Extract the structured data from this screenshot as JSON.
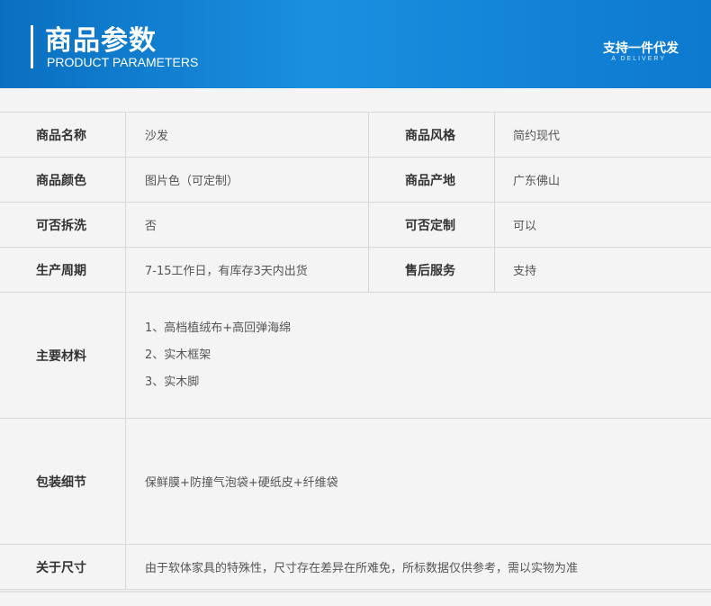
{
  "banner": {
    "title_cn": "商品参数",
    "title_en": "PRODUCT PARAMETERS",
    "slogan_cn": "支持一件代发",
    "slogan_en": "A DELIVERY"
  },
  "rows": [
    {
      "label_left": "商品名称",
      "value_left": "沙发",
      "label_right": "商品风格",
      "value_right": "简约现代"
    },
    {
      "label_left": "商品颜色",
      "value_left": "图片色（可定制）",
      "label_right": "商品产地",
      "value_right": "广东佛山"
    },
    {
      "label_left": "可否拆洗",
      "value_left": "否",
      "label_right": "可否定制",
      "value_right": "可以"
    },
    {
      "label_left": "生产周期",
      "value_left": "7-15工作日，有库存3天内出货",
      "label_right": "售后服务",
      "value_right": "支持"
    }
  ],
  "materials": {
    "label": "主要材料",
    "items": [
      "1、高档植绒布+高回弹海绵",
      "2、实木框架",
      "3、实木脚"
    ]
  },
  "packing": {
    "label": "包装细节",
    "value": "保鲜膜+防撞气泡袋+硬纸皮+纤维袋"
  },
  "size": {
    "label": "关于尺寸",
    "value": "由于软体家具的特殊性，尺寸存在差异在所难免，所标数据仅供参考，需以实物为准"
  }
}
